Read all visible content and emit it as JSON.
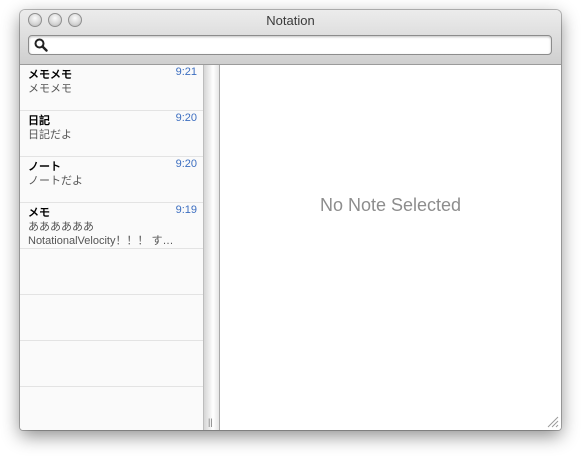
{
  "window": {
    "title": "Notation"
  },
  "search": {
    "value": "",
    "placeholder": ""
  },
  "notes": [
    {
      "title": "メモメモ",
      "time": "9:21",
      "lines": [
        "メモメモ"
      ]
    },
    {
      "title": "日記",
      "time": "9:20",
      "lines": [
        "日記だよ"
      ]
    },
    {
      "title": "ノート",
      "time": "9:20",
      "lines": [
        "ノートだよ"
      ]
    },
    {
      "title": "メモ",
      "time": "9:19",
      "lines": [
        "ああああああ",
        "NotationalVelocity！！！ す…"
      ]
    }
  ],
  "detail": {
    "empty_message": "No Note Selected"
  },
  "colors": {
    "time": "#3c6ec0",
    "empty_message": "#8d8d8d",
    "list_bg": "#fafafa"
  },
  "icons": {
    "search": "search-icon",
    "resize": "resize-grip-icon",
    "splitter": "splitter-grip-icon"
  }
}
